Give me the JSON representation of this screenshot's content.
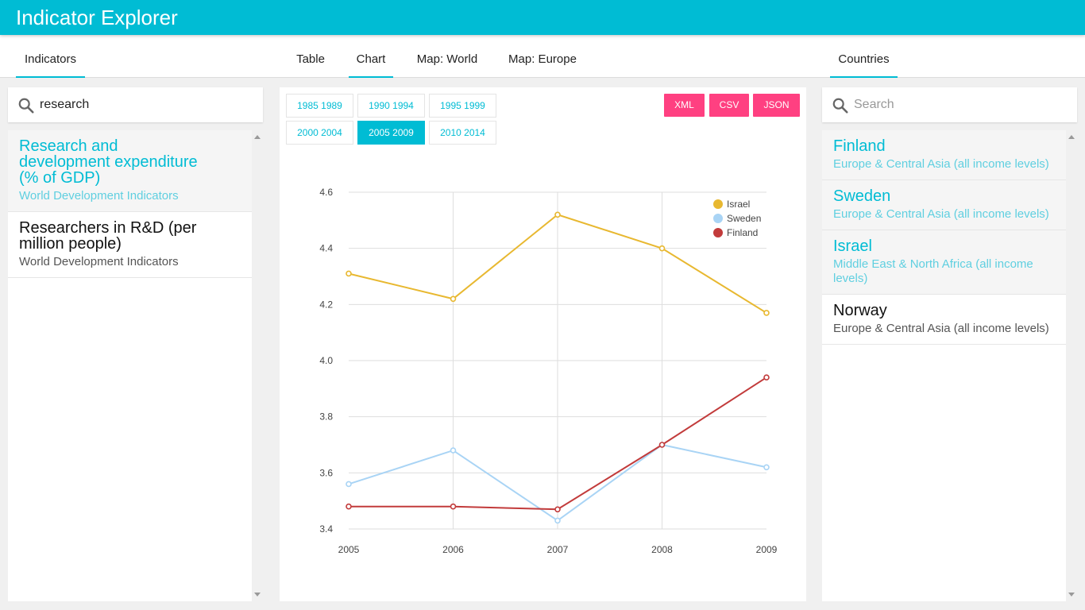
{
  "app": {
    "title": "Indicator Explorer"
  },
  "tabs": {
    "indicators": "Indicators",
    "table": "Table",
    "chart": "Chart",
    "map_world": "Map: World",
    "map_europe": "Map: Europe",
    "countries": "Countries"
  },
  "indicator_search": {
    "value": "research"
  },
  "indicators": [
    {
      "title": "Research and development expenditure (% of GDP)",
      "source": "World Development Indicators"
    },
    {
      "title": "Researchers in R&D (per million people)",
      "source": "World Development Indicators"
    }
  ],
  "ranges": [
    "1985 1989",
    "1990 1994",
    "1995 1999",
    "2000 2004",
    "2005 2009",
    "2010 2014"
  ],
  "active_range": "2005 2009",
  "downloads": {
    "xml": "XML",
    "csv": "CSV",
    "json": "JSON"
  },
  "country_search": {
    "placeholder": "Search"
  },
  "countries": [
    {
      "name": "Finland",
      "region": "Europe & Central Asia (all income levels)"
    },
    {
      "name": "Sweden",
      "region": "Europe & Central Asia (all income levels)"
    },
    {
      "name": "Israel",
      "region": "Middle East & North Africa (all income levels)"
    },
    {
      "name": "Norway",
      "region": "Europe & Central Asia (all income levels)"
    }
  ],
  "chart_data": {
    "type": "line",
    "x": [
      "2005",
      "2006",
      "2007",
      "2008",
      "2009"
    ],
    "ylim": [
      3.4,
      4.6
    ],
    "yticks": [
      "3.4",
      "3.6",
      "3.8",
      "4.0",
      "4.2",
      "4.4",
      "4.6"
    ],
    "grid": true,
    "legend_position": "top-right",
    "series": [
      {
        "name": "Israel",
        "color": "#e8b830",
        "values": [
          4.31,
          4.22,
          4.52,
          4.4,
          4.17
        ]
      },
      {
        "name": "Sweden",
        "color": "#a9d4f5",
        "values": [
          3.56,
          3.68,
          3.43,
          3.7,
          3.62
        ]
      },
      {
        "name": "Finland",
        "color": "#c23b3b",
        "values": [
          3.48,
          3.48,
          3.47,
          3.7,
          3.94
        ]
      }
    ]
  }
}
